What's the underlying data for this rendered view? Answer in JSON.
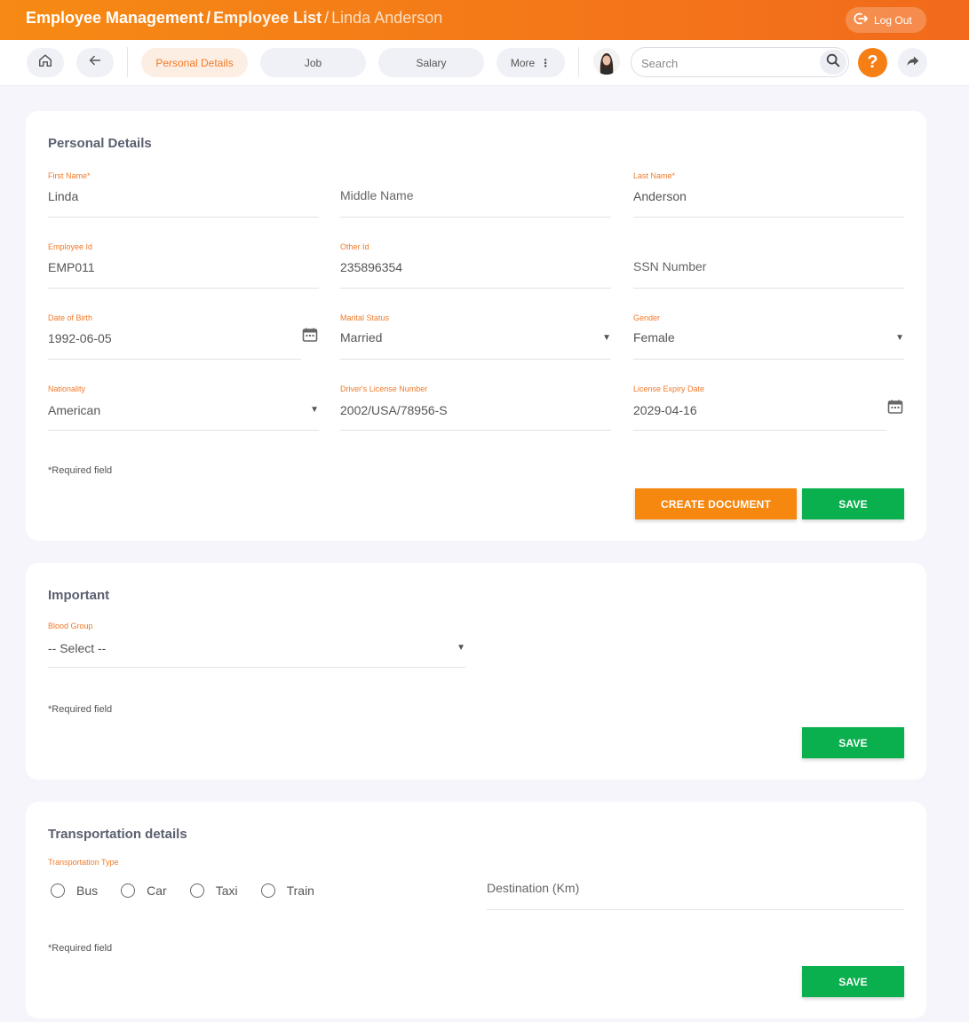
{
  "header": {
    "breadcrumb": [
      "Employee Management",
      "Employee List",
      "Linda Anderson"
    ],
    "separator": "/",
    "logout_label": "Log Out"
  },
  "toolbar": {
    "tabs": [
      {
        "label": "Personal Details",
        "active": true
      },
      {
        "label": "Job",
        "active": false
      },
      {
        "label": "Salary",
        "active": false
      },
      {
        "label": "More",
        "active": false
      }
    ],
    "search_placeholder": "Search",
    "help_glyph": "?"
  },
  "personal_details": {
    "title": "Personal Details",
    "fields": {
      "first_name": {
        "label": "First Name",
        "value": "Linda",
        "required": true
      },
      "middle_name": {
        "placeholder": "Middle Name"
      },
      "last_name": {
        "label": "Last Name",
        "value": "Anderson",
        "required": true
      },
      "employee_id": {
        "label": "Employee Id",
        "value": "EMP011"
      },
      "other_id": {
        "label": "Other Id",
        "value": "235896354"
      },
      "ssn": {
        "placeholder": "SSN Number"
      },
      "dob": {
        "label": "Date of Birth",
        "value": "1992-06-05"
      },
      "marital_status": {
        "label": "Marital Status",
        "value": "Married"
      },
      "gender": {
        "label": "Gender",
        "value": "Female"
      },
      "nationality": {
        "label": "Nationality",
        "value": "American"
      },
      "license_number": {
        "label": "Driver's License Number",
        "value": "2002/USA/78956-S"
      },
      "license_expiry": {
        "label": "License Expiry Date",
        "value": "2029-04-16"
      }
    },
    "required_note": "Required field",
    "create_document_label": "CREATE DOCUMENT",
    "save_label": "SAVE"
  },
  "important": {
    "title": "Important",
    "blood_group": {
      "label": "Blood Group",
      "value": "-- Select --"
    },
    "required_note": "Required field",
    "save_label": "SAVE"
  },
  "transportation": {
    "title": "Transportation details",
    "type_label": "Transportation Type",
    "options": [
      "Bus",
      "Car",
      "Taxi",
      "Train"
    ],
    "destination_placeholder": "Destination (Km)",
    "required_note": "Required field",
    "save_label": "SAVE"
  },
  "colors": {
    "accent": "#f57e15",
    "label": "#f07a2a",
    "save": "#0ab04e",
    "create_document": "#f6870f"
  }
}
